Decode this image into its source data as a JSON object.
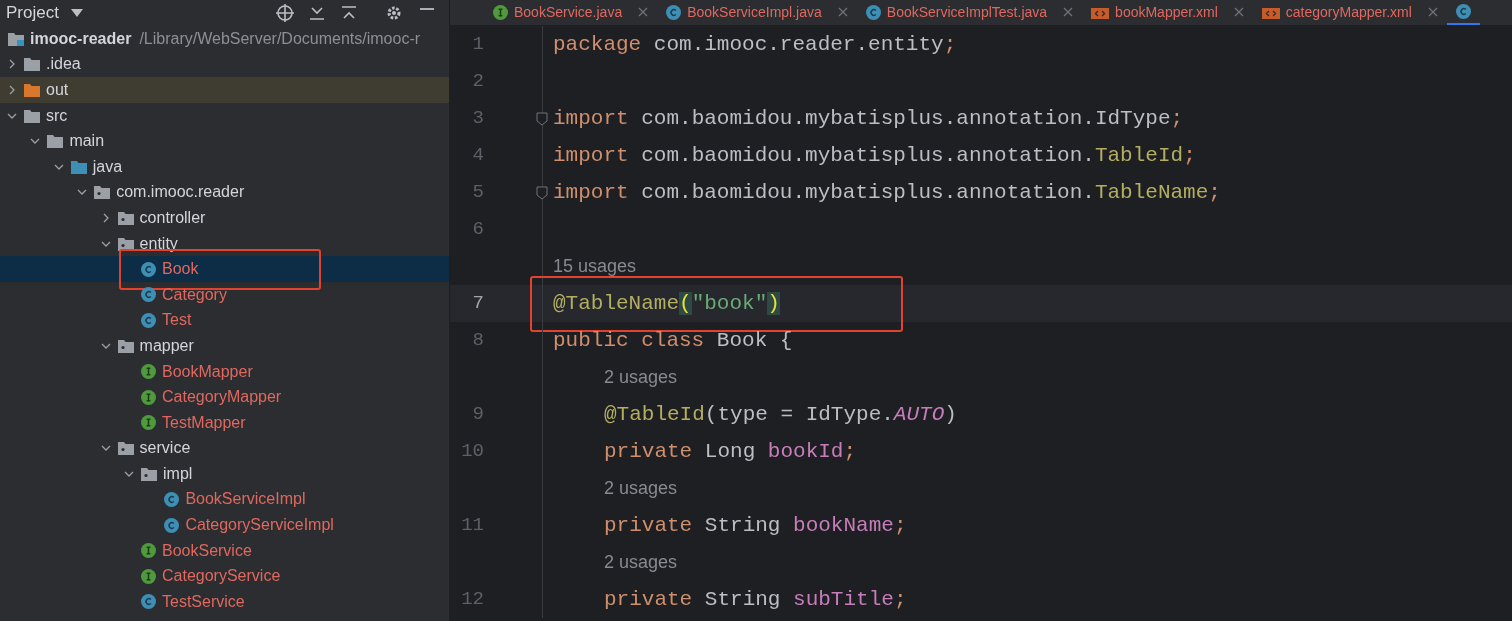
{
  "sidebar": {
    "title": "Project",
    "tree": [
      {
        "label": "imooc-reader",
        "path": "/Library/WebServer/Documents/imooc-r",
        "kind": "project",
        "selected": false,
        "children": [
          {
            "label": ".idea",
            "kind": "folder",
            "expanded": false,
            "selected": false
          },
          {
            "label": "out",
            "kind": "excluded",
            "expanded": false,
            "selected": false
          },
          {
            "label": "src",
            "kind": "folder",
            "expanded": true,
            "selected": false,
            "children": [
              {
                "label": "main",
                "kind": "folder",
                "expanded": true,
                "selected": false,
                "children": [
                  {
                    "label": "java",
                    "kind": "source",
                    "expanded": true,
                    "selected": false,
                    "children": [
                      {
                        "label": "com.imooc.reader",
                        "kind": "package",
                        "expanded": true,
                        "selected": false,
                        "children": [
                          {
                            "label": "controller",
                            "kind": "package",
                            "expanded": false,
                            "selected": false
                          },
                          {
                            "label": "entity",
                            "kind": "package",
                            "expanded": true,
                            "selected": false,
                            "children": [
                              {
                                "label": "Book",
                                "kind": "class",
                                "selected": true,
                                "annotated": true
                              },
                              {
                                "label": "Category",
                                "kind": "class",
                                "selected": false
                              },
                              {
                                "label": "Test",
                                "kind": "class",
                                "selected": false
                              }
                            ]
                          },
                          {
                            "label": "mapper",
                            "kind": "package",
                            "expanded": true,
                            "selected": false,
                            "children": [
                              {
                                "label": "BookMapper",
                                "kind": "interface",
                                "selected": false
                              },
                              {
                                "label": "CategoryMapper",
                                "kind": "interface",
                                "selected": false
                              },
                              {
                                "label": "TestMapper",
                                "kind": "interface",
                                "selected": false
                              }
                            ]
                          },
                          {
                            "label": "service",
                            "kind": "package",
                            "expanded": true,
                            "selected": false,
                            "children": [
                              {
                                "label": "impl",
                                "kind": "package",
                                "expanded": true,
                                "selected": false,
                                "children": [
                                  {
                                    "label": "BookServiceImpl",
                                    "kind": "class",
                                    "selected": false
                                  },
                                  {
                                    "label": "CategoryServiceImpl",
                                    "kind": "class",
                                    "selected": false
                                  }
                                ]
                              },
                              {
                                "label": "BookService",
                                "kind": "interface",
                                "selected": false
                              },
                              {
                                "label": "CategoryService",
                                "kind": "interface",
                                "selected": false
                              },
                              {
                                "label": "TestService",
                                "kind": "class",
                                "selected": false
                              }
                            ]
                          }
                        ]
                      }
                    ]
                  }
                ]
              }
            ]
          }
        ]
      }
    ]
  },
  "tabs": [
    {
      "label": "BookService.java",
      "kind": "interface",
      "selected": false
    },
    {
      "label": "BookServiceImpl.java",
      "kind": "class",
      "selected": false
    },
    {
      "label": "BookServiceImplTest.java",
      "kind": "class",
      "selected": false
    },
    {
      "label": "bookMapper.xml",
      "kind": "xml",
      "selected": false
    },
    {
      "label": "categoryMapper.xml",
      "kind": "xml",
      "selected": false
    },
    {
      "kind": "class",
      "selected": true
    }
  ],
  "editor": {
    "lines": [
      {
        "kind": "code",
        "number": "1",
        "tokens": [
          {
            "text": "package",
            "kind": "keyword"
          },
          {
            "text": " com.imooc.reader.entity",
            "kind": "plain"
          },
          {
            "text": ";",
            "kind": "keyword"
          }
        ]
      },
      {
        "kind": "code",
        "number": "2"
      },
      {
        "kind": "code",
        "number": "3",
        "fold": true,
        "tokens": [
          {
            "text": "import",
            "kind": "keyword"
          },
          {
            "text": " com.baomidou.mybatisplus.annotation.IdType",
            "kind": "plain"
          },
          {
            "text": ";",
            "kind": "keyword"
          }
        ]
      },
      {
        "kind": "code",
        "number": "4",
        "tokens": [
          {
            "text": "import",
            "kind": "keyword"
          },
          {
            "text": " com.baomidou.mybatisplus.annotation.",
            "kind": "plain"
          },
          {
            "text": "TableId",
            "kind": "annotation"
          },
          {
            "text": ";",
            "kind": "keyword"
          }
        ]
      },
      {
        "kind": "code",
        "number": "5",
        "fold": true,
        "tokens": [
          {
            "text": "import",
            "kind": "keyword"
          },
          {
            "text": " com.baomidou.mybatisplus.annotation.",
            "kind": "plain"
          },
          {
            "text": "TableName",
            "kind": "annotation"
          },
          {
            "text": ";",
            "kind": "keyword"
          }
        ]
      },
      {
        "kind": "code",
        "number": "6"
      },
      {
        "kind": "usages",
        "text": "15 usages"
      },
      {
        "kind": "code",
        "number": "7",
        "current": true,
        "annotated": true,
        "tokens": [
          {
            "text": "@TableName",
            "kind": "annotation"
          },
          {
            "text": "(",
            "kind": "brace"
          },
          {
            "text": "\"book\"",
            "kind": "string"
          },
          {
            "text": ")",
            "kind": "brace"
          }
        ]
      },
      {
        "kind": "code",
        "number": "8",
        "tokens": [
          {
            "text": "public class",
            "kind": "keyword"
          },
          {
            "text": " Book {",
            "kind": "plain"
          }
        ],
        "children": [
          {
            "kind": "usages",
            "text": "2 usages"
          },
          {
            "kind": "code",
            "number": "9",
            "tokens": [
              {
                "text": "@TableId",
                "kind": "annotation"
              },
              {
                "text": "(type = IdType.",
                "kind": "plain"
              },
              {
                "text": "AUTO",
                "kind": "constant"
              },
              {
                "text": ")",
                "kind": "plain"
              }
            ]
          },
          {
            "kind": "code",
            "number": "10",
            "tokens": [
              {
                "text": "private",
                "kind": "keyword"
              },
              {
                "text": " Long ",
                "kind": "plain"
              },
              {
                "text": "bookId",
                "kind": "field"
              },
              {
                "text": ";",
                "kind": "keyword"
              }
            ]
          },
          {
            "kind": "usages",
            "text": "2 usages"
          },
          {
            "kind": "code",
            "number": "11",
            "tokens": [
              {
                "text": "private",
                "kind": "keyword"
              },
              {
                "text": " String ",
                "kind": "plain"
              },
              {
                "text": "bookName",
                "kind": "field"
              },
              {
                "text": ";",
                "kind": "keyword"
              }
            ]
          },
          {
            "kind": "usages",
            "text": "2 usages"
          },
          {
            "kind": "code",
            "number": "12",
            "tokens": [
              {
                "text": "private",
                "kind": "keyword"
              },
              {
                "text": " String ",
                "kind": "plain"
              },
              {
                "text": "subTitle",
                "kind": "field"
              },
              {
                "text": ";",
                "kind": "keyword"
              }
            ]
          }
        ]
      }
    ]
  }
}
